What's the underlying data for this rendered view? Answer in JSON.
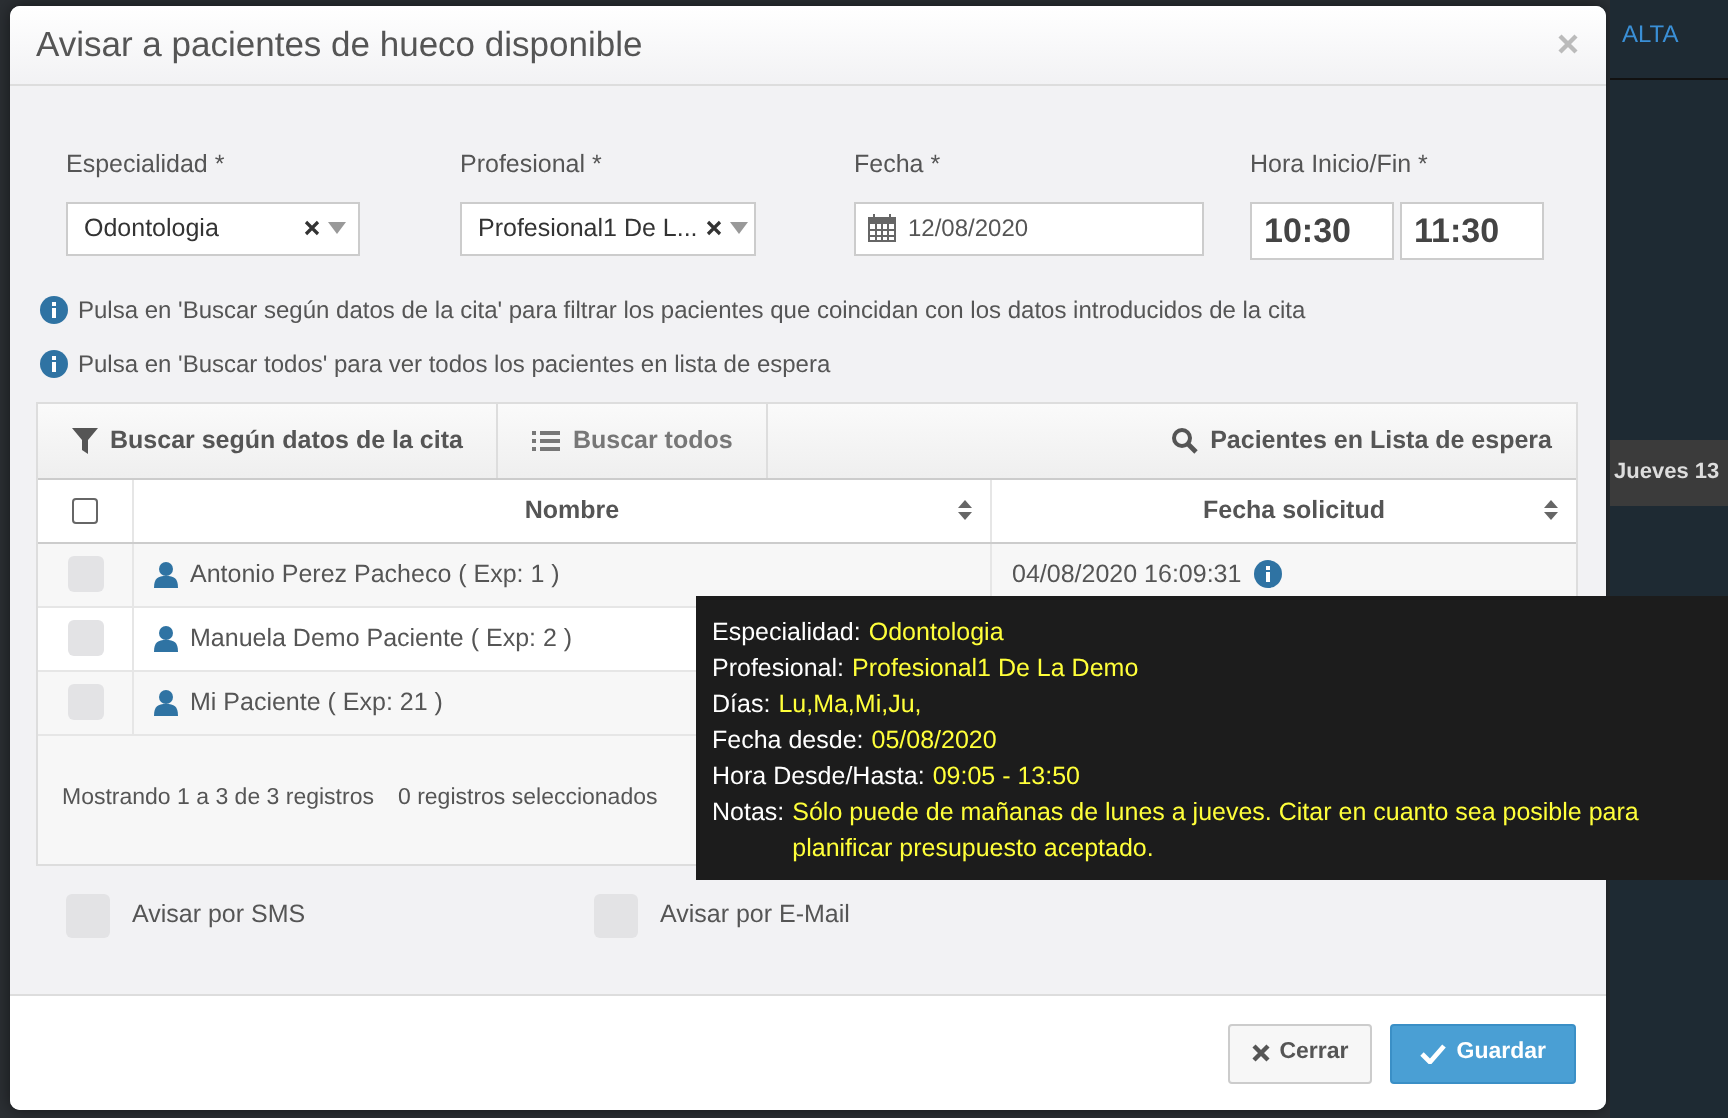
{
  "background": {
    "header_link": "ALTA",
    "column_header": "Jueves 13"
  },
  "dialog": {
    "title": "Avisar a pacientes de hueco disponible"
  },
  "form": {
    "especialidad": {
      "label": "Especialidad *",
      "value": "Odontologia"
    },
    "profesional": {
      "label": "Profesional *",
      "value": "Profesional1 De L..."
    },
    "fecha": {
      "label": "Fecha *",
      "value": "12/08/2020"
    },
    "hora": {
      "label": "Hora Inicio/Fin *",
      "start": "10:30",
      "end": "11:30"
    }
  },
  "hints": [
    "Pulsa en 'Buscar según datos de la cita' para filtrar los pacientes que coincidan con los datos introducidos de la cita",
    "Pulsa en 'Buscar todos' para ver todos los pacientes en lista de espera"
  ],
  "toolbar": {
    "buttons": [
      {
        "label": "Buscar según datos de la cita",
        "kind": "filter"
      },
      {
        "label": "Buscar todos",
        "kind": "list"
      }
    ],
    "search_label": "Pacientes en Lista de espera"
  },
  "table": {
    "header_checked": false,
    "columns": [
      "Nombre",
      "Fecha solicitud"
    ],
    "rows": [
      {
        "checked": false,
        "name": "Antonio Perez Pacheco ( Exp: 1 )",
        "date": "04/08/2020 16:09:31"
      },
      {
        "checked": false,
        "name": "Manuela Demo Paciente ( Exp: 2 )"
      },
      {
        "checked": false,
        "name": "Mi Paciente ( Exp: 21 )"
      }
    ],
    "showing": "Mostrando 1 a 3 de 3 registros",
    "selected_count": "0 registros seleccionados"
  },
  "tooltip": [
    {
      "label": "Especialidad:",
      "value": "Odontologia"
    },
    {
      "label": "Profesional:",
      "value": "Profesional1 De La Demo"
    },
    {
      "label": "Días:",
      "value": "Lu,Ma,Mi,Ju,"
    },
    {
      "label": "Fecha desde:",
      "value": "05/08/2020"
    },
    {
      "label": "Hora Desde/Hasta:",
      "value": "09:05 - 13:50"
    },
    {
      "label": "Notas:",
      "value": "Sólo puede de mañanas de lunes a jueves. Citar en cuanto sea posible para planificar presupuesto aceptado."
    }
  ],
  "notify": [
    {
      "label": "Avisar por SMS",
      "checked": false
    },
    {
      "label": "Avisar por E-Mail",
      "checked": false
    }
  ],
  "buttons": [
    {
      "label": "Cerrar",
      "kind": "close"
    },
    {
      "label": "Guardar",
      "kind": "save"
    }
  ]
}
